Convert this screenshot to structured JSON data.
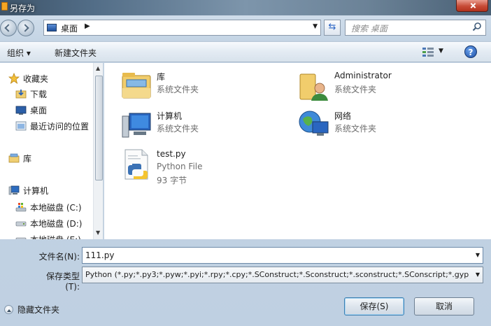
{
  "window": {
    "title": "另存为"
  },
  "address": {
    "location": "桌面",
    "search_placeholder": "搜索 桌面"
  },
  "toolbar": {
    "organize": "组织 ▾",
    "new_folder": "新建文件夹"
  },
  "nav": {
    "items": [
      {
        "label": "收藏夹",
        "icon": "star-icon"
      },
      {
        "label": "下载",
        "icon": "downloads-folder-icon"
      },
      {
        "label": "桌面",
        "icon": "desktop-icon"
      },
      {
        "label": "最近访问的位置",
        "icon": "recent-places-icon"
      },
      {
        "label": "库",
        "icon": "library-icon"
      },
      {
        "label": "计算机",
        "icon": "computer-icon"
      },
      {
        "label": "本地磁盘 (C:)",
        "icon": "drive-c-icon"
      },
      {
        "label": "本地磁盘 (D:)",
        "icon": "drive-icon"
      },
      {
        "label": "本地磁盘 (E:)",
        "icon": "drive-icon"
      }
    ]
  },
  "files": [
    {
      "name": "库",
      "type": "系统文件夹",
      "size": "",
      "icon": "library-folder-icon"
    },
    {
      "name": "Administrator",
      "type": "系统文件夹",
      "size": "",
      "icon": "user-folder-icon"
    },
    {
      "name": "计算机",
      "type": "系统文件夹",
      "size": "",
      "icon": "computer-icon"
    },
    {
      "name": "网络",
      "type": "系统文件夹",
      "size": "",
      "icon": "network-icon"
    },
    {
      "name": "test.py",
      "type": "Python File",
      "size": "93 字节",
      "icon": "python-file-icon"
    }
  ],
  "form": {
    "filename_label": "文件名(N):",
    "filename_value": "111.py",
    "filetype_label": "保存类型(T):",
    "filetype_value": "Python (*.py;*.py3;*.pyw;*.pyi;*.rpy;*.cpy;*.SConstruct;*.Sconstruct;*.sconstruct;*.SConscript;*.gyp;*"
  },
  "footer": {
    "hide_folders": "隐藏文件夹",
    "save": "保存(S)",
    "cancel": "取消"
  },
  "colors": {
    "accent": "#2b64c4",
    "title_bar": "#516c86",
    "close": "#c74b36"
  }
}
